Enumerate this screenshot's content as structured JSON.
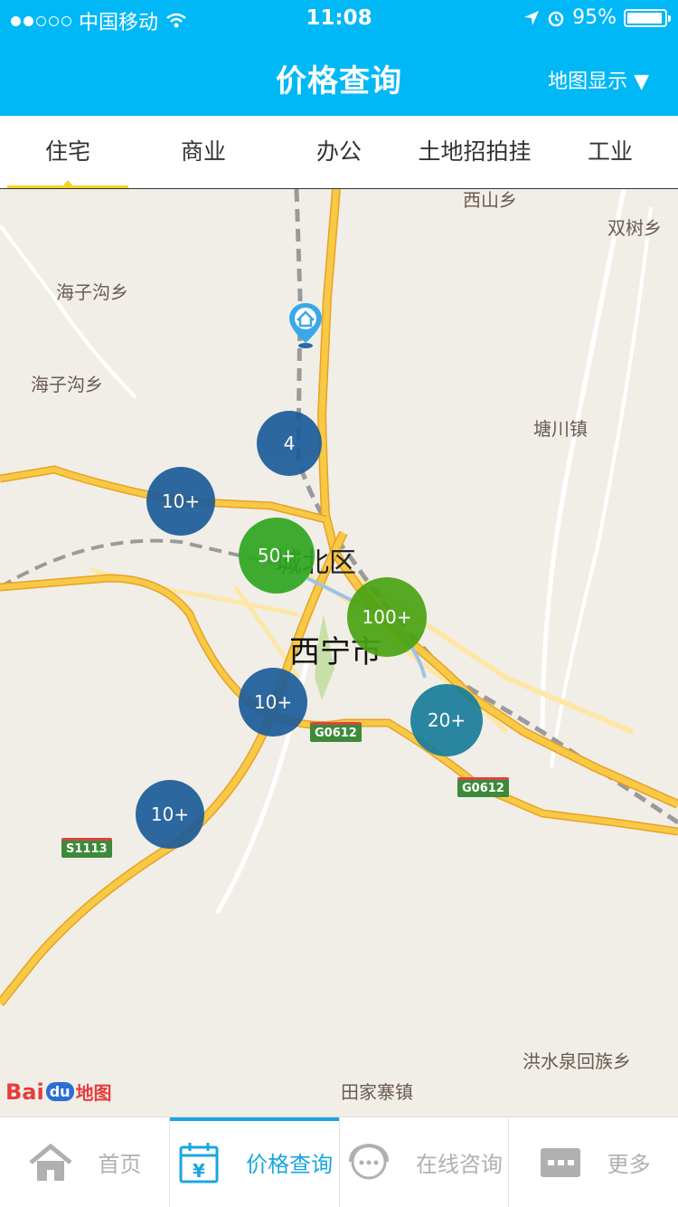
{
  "status": {
    "carrier": "中国移动",
    "time": "11:08",
    "battery": "95%",
    "battery_level": 0.95
  },
  "nav": {
    "title": "价格查询",
    "right_label": "地图显示 ▼"
  },
  "tabs": [
    {
      "label": "住宅",
      "active": true
    },
    {
      "label": "商业"
    },
    {
      "label": "办公"
    },
    {
      "label": "土地招拍挂"
    },
    {
      "label": "工业"
    }
  ],
  "map": {
    "labels": {
      "xishan": "西山乡",
      "shuangshu": "双树乡",
      "haizigou1": "海子沟乡",
      "haizigou2": "海子沟乡",
      "tangchuan": "塘川镇",
      "hongshuiquan": "洪水泉回族乡",
      "tianjiazhai": "田家寨镇"
    },
    "district": "城北区",
    "city": "西宁市",
    "shields": {
      "g0612_a": "G0612",
      "g0612_b": "G0612",
      "s1113": "S1113"
    },
    "clusters": [
      {
        "label": "4"
      },
      {
        "label": "10+"
      },
      {
        "label": "50+"
      },
      {
        "label": "100+"
      },
      {
        "label": "10+"
      },
      {
        "label": "20+"
      },
      {
        "label": "10+"
      }
    ],
    "logo": {
      "bai": "Bai",
      "du": "du",
      "map": "地图"
    }
  },
  "bottom": [
    {
      "label": "首页",
      "icon": "home-icon"
    },
    {
      "label": "价格查询",
      "icon": "price-calendar-icon",
      "active": true
    },
    {
      "label": "在线咨询",
      "icon": "chat-icon"
    },
    {
      "label": "更多",
      "icon": "more-icon"
    }
  ],
  "colors": {
    "header": "#00b8f6",
    "tab_indicator": "#f5d327",
    "active_bottom": "#1aa6e0",
    "road": "#f6bf3a"
  }
}
